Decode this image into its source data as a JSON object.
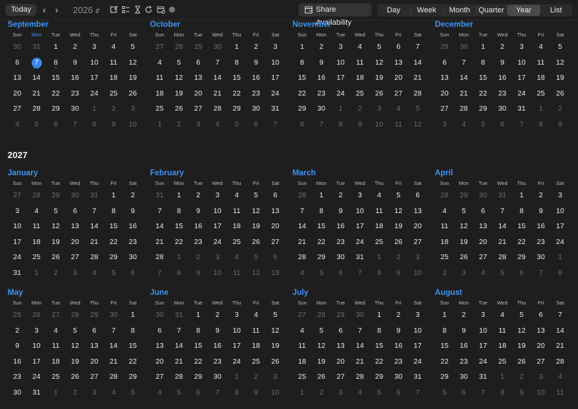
{
  "toolbar": {
    "today_label": "Today",
    "prev_icon": "chevron-left-icon",
    "next_icon": "chevron-right-icon",
    "year": "2026",
    "share_label": "Share Availability",
    "views": [
      "Day",
      "Week",
      "Month",
      "Quarter",
      "Year",
      "List"
    ],
    "active_view": "Year"
  },
  "weekdays": [
    "Sun",
    "Mon",
    "Tue",
    "Wed",
    "Thu",
    "Fri",
    "Sat"
  ],
  "colors": {
    "accent": "#3f93f4",
    "today_fill": "#3a86f0",
    "background": "#1e1e1e"
  },
  "rows": [
    {
      "months": [
        {
          "name": "September",
          "year": 2026,
          "month": 9,
          "today": 7,
          "event_dot_days": [
            7,
            8
          ],
          "dots_today": "••••"
        },
        {
          "name": "October",
          "year": 2026,
          "month": 10
        },
        {
          "name": "November",
          "year": 2026,
          "month": 11
        },
        {
          "name": "December",
          "year": 2026,
          "month": 12
        }
      ]
    },
    {
      "year_heading": "2027",
      "months": [
        {
          "name": "January",
          "year": 2027,
          "month": 1
        },
        {
          "name": "February",
          "year": 2027,
          "month": 2
        },
        {
          "name": "March",
          "year": 2027,
          "month": 3
        },
        {
          "name": "April",
          "year": 2027,
          "month": 4
        }
      ]
    },
    {
      "months": [
        {
          "name": "May",
          "year": 2027,
          "month": 5
        },
        {
          "name": "June",
          "year": 2027,
          "month": 6
        },
        {
          "name": "July",
          "year": 2027,
          "month": 7
        },
        {
          "name": "August",
          "year": 2027,
          "month": 8
        }
      ]
    }
  ]
}
